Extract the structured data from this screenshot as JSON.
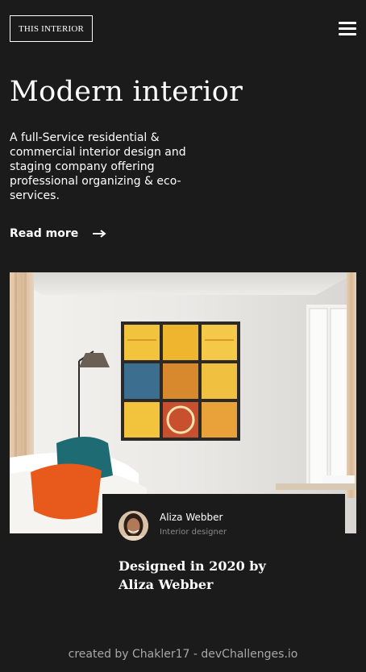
{
  "header": {
    "logo_text": "THIS INTERIOR",
    "menu_icon": "hamburger-icon"
  },
  "hero": {
    "title": "Modern interior",
    "description": "A full-Service residential & commercial interior design and staging company offering professional organizing & eco-services.",
    "read_more_label": "Read more",
    "read_more_icon": "arrow-right-icon"
  },
  "photo": {
    "subject": "living-room-photo"
  },
  "card": {
    "author_name": "Aliza Webber",
    "author_role": "Interior designer",
    "title": "Designed in 2020 by Aliza Webber"
  },
  "footer": {
    "text": "created by Chakler17 - devChallenges.io"
  },
  "colors": {
    "background": "#1c1b1c",
    "text": "#ffffff",
    "muted": "#8a8a8a"
  }
}
